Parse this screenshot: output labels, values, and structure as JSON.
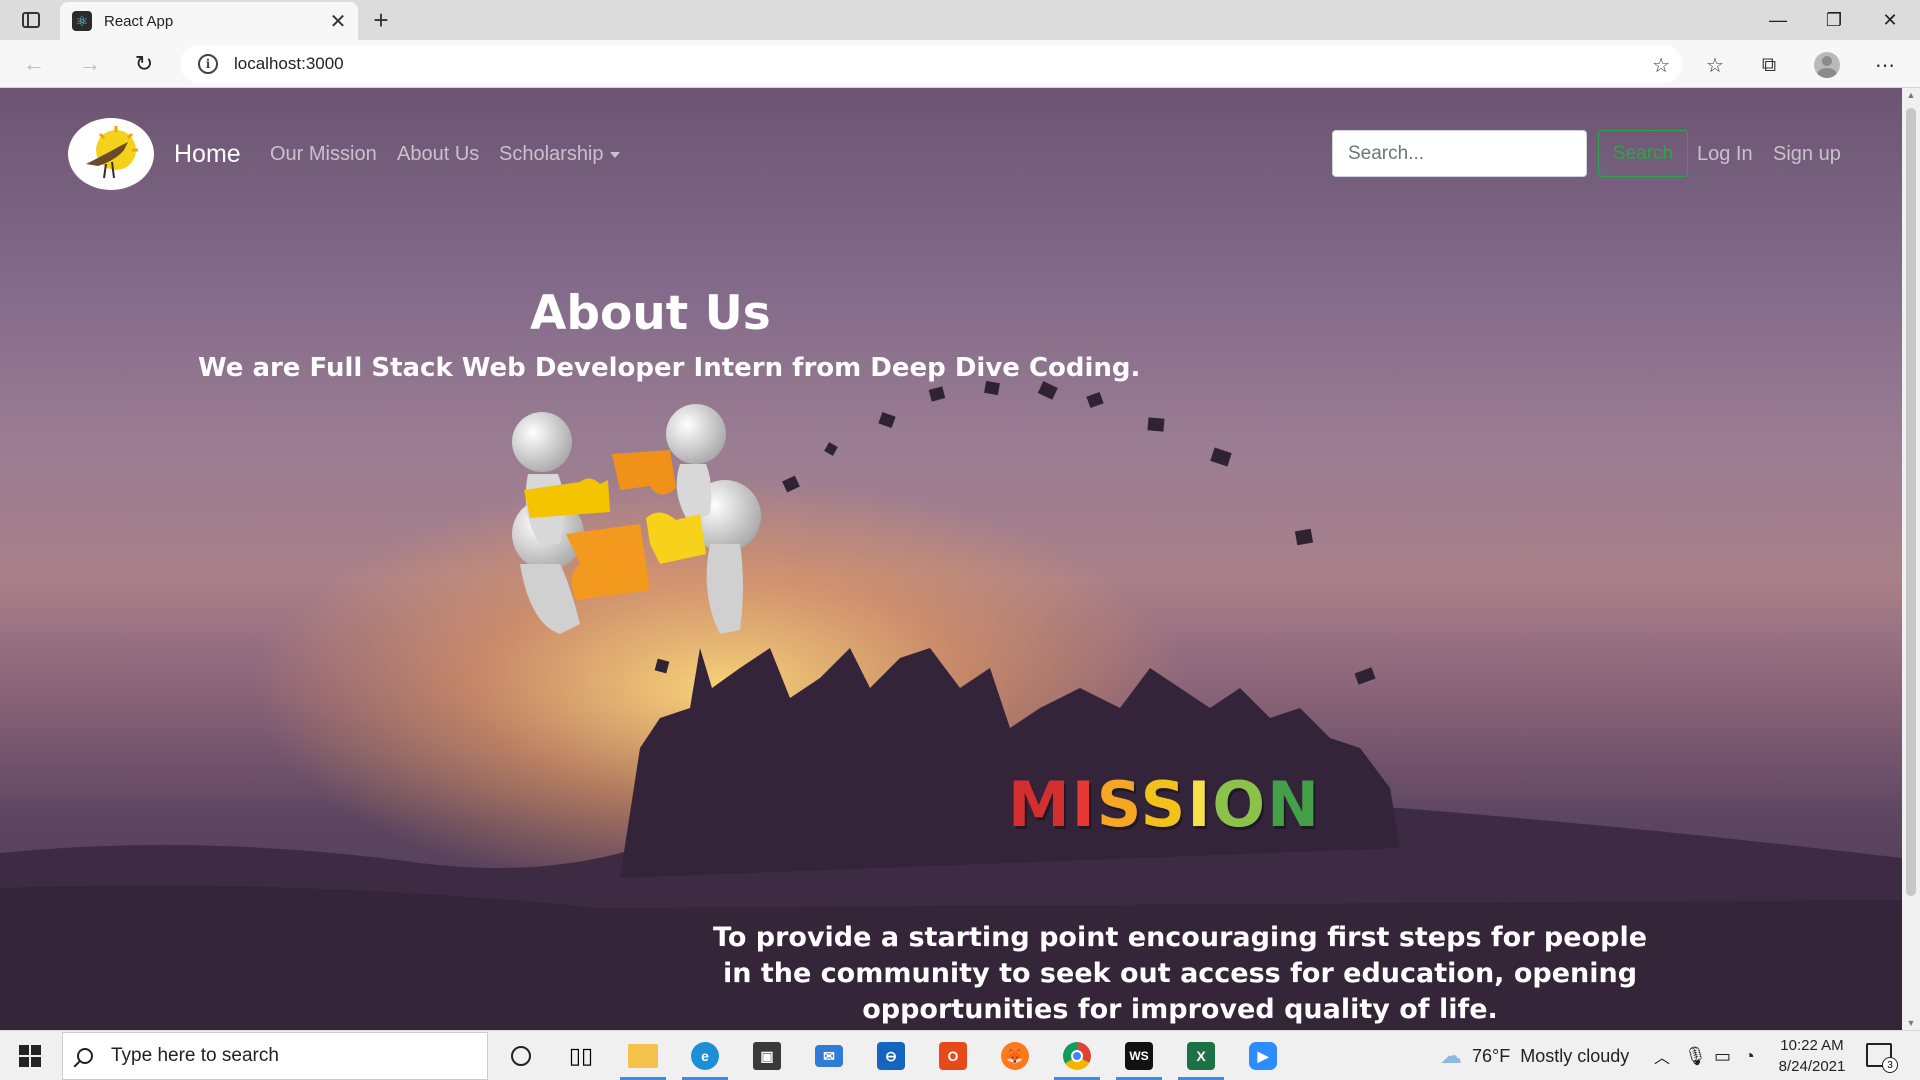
{
  "browser": {
    "tab_title": "React App",
    "url": "localhost:3000"
  },
  "navbar": {
    "brand": "Home",
    "links": [
      "Our Mission",
      "About Us",
      "Scholarship"
    ],
    "search_placeholder": "Search...",
    "search_button": "Search",
    "login": "Log In",
    "signup": "Sign up"
  },
  "about": {
    "title": "About Us",
    "subtitle": "We are Full Stack Web Developer Intern from Deep Dive Coding."
  },
  "mission": {
    "graphic_letters": [
      "M",
      "I",
      "S",
      "S",
      "I",
      "O",
      "N"
    ],
    "letter_colors": [
      "#d32f2f",
      "#e53935",
      "#f5a623",
      "#f2c21b",
      "#f7e04a",
      "#8bc34a",
      "#43a047"
    ],
    "text_lines": [
      "To provide a starting point encouraging first steps for people",
      "in the community to seek out access for education, opening",
      "opportunities for improved quality of life."
    ]
  },
  "taskbar": {
    "search_placeholder": "Type here to search",
    "weather": "76°F  Mostly cloudy",
    "time": "10:22 AM",
    "date": "8/24/2021",
    "notification_count": "3"
  },
  "colors": {
    "search_button": "#28a745",
    "nav_link": "rgba(255,255,255,0.62)",
    "accent": "#3a8ee6"
  }
}
